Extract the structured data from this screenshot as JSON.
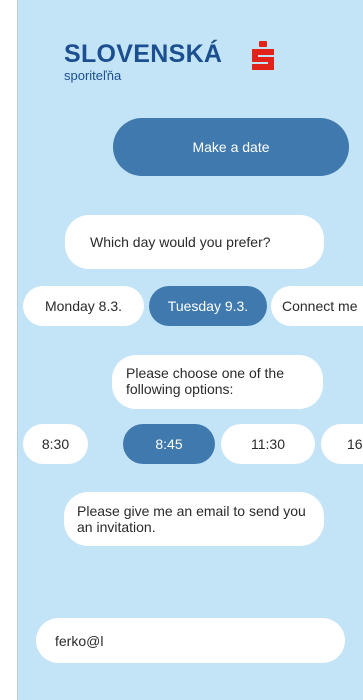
{
  "brand": {
    "name": "SLOVENSKÁ",
    "subname": "sporiteľňa",
    "color": "#1c4f8f",
    "accent": "#e2231a"
  },
  "colors": {
    "panel": "#c3e4f7",
    "primary": "#3f79ad",
    "bubble": "#ffffff"
  },
  "actions": {
    "make_date_label": "Make a date"
  },
  "chat": {
    "day_prompt": "Which day would you prefer?",
    "options_prompt": "Please choose one of the following options:",
    "email_prompt": "Please give me an email to send you an invitation."
  },
  "day_options": [
    {
      "label": "Monday 8.3.",
      "selected": false
    },
    {
      "label": "Tuesday 9.3.",
      "selected": true
    },
    {
      "label": "Connect me",
      "selected": false
    }
  ],
  "time_options": [
    {
      "label": "8:30",
      "selected": false
    },
    {
      "label": "8:45",
      "selected": true
    },
    {
      "label": "11:30",
      "selected": false
    },
    {
      "label": "16",
      "selected": false
    }
  ],
  "email_input": {
    "value": "ferko@l"
  }
}
